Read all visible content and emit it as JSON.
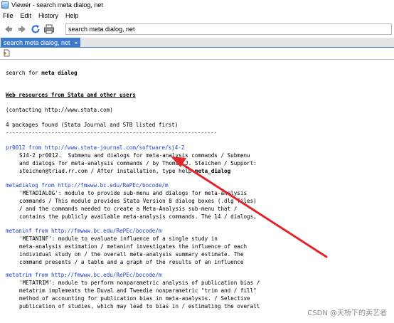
{
  "window": {
    "title": "Viewer - search meta dialog, net"
  },
  "menu": [
    "File",
    "Edit",
    "History",
    "Help"
  ],
  "toolbar": {
    "address_value": "search meta dialog, net"
  },
  "tab": {
    "label": "search meta dialog, net",
    "close": "×"
  },
  "content": {
    "query_prefix": "search for ",
    "query_term": "meta dialog",
    "heading": "Web resources from Stata and other users",
    "contacting": "(contacting http://www.stata.com)",
    "found": "4 packages found (Stata Journal and STB listed first)",
    "separator": "-----------------------------------------------------------------",
    "packages": [
      {
        "name": "pr0012",
        "from": " from ",
        "url": "http://www.stata-journal.com/software/sj4-2",
        "lines": [
          "SJ4-2 pr0012.  Submenu and dialogs for meta-analysis commands / Submenu",
          "and dialogs for meta-analysis commands / by Thomas J. Steichen / Support:"
        ],
        "last_prefix": "steichen@triad.rr.com / After installation, type help ",
        "last_bold": "meta_dialog"
      },
      {
        "name": "metadialog",
        "from": " from ",
        "url": "http://fmwww.bc.edu/RePEc/bocode/m",
        "lines": [
          "'METADIALOG': module to provide sub-menu and dialogs for meta-analysis",
          "commands / This module provides Stata Version 8 dialog boxes (.dlg files)",
          "/ and the commands needed to create a Meta-Analysis sub-menu that /",
          "contains the publicly available meta-analysis commands. The 14 / dialogs,"
        ]
      },
      {
        "name": "metaninf",
        "from": " from ",
        "url": "http://fmwww.bc.edu/RePEc/bocode/m",
        "lines": [
          "'METANINF': module to evaluate influence of a single study in",
          "meta-analysis estimation / metaninf investigates the influence of each",
          "individual study on / the overall meta-analysis summary estimate. The",
          "command presents / a table and a graph of the results of an influence"
        ]
      },
      {
        "name": "metatrim",
        "from": " from ",
        "url": "http://fmwww.bc.edu/RePEc/bocode/m",
        "lines": [
          "'METATRIM': module to perform nonparametric analysis of publication bias /",
          "metatrim implements the Duval and Tweedie nonparametric \"trim and / fill\"",
          "method of accounting for publication bias in meta-analysis. / Selective",
          "publication of studies, which may lead to bias in / estimating the overall"
        ]
      }
    ]
  },
  "watermark": "CSDN @天桥下的卖艺者",
  "colors": {
    "tab_active": "#3d7ac9",
    "link": "#1a3fc4",
    "arrow": "#e0242a"
  }
}
